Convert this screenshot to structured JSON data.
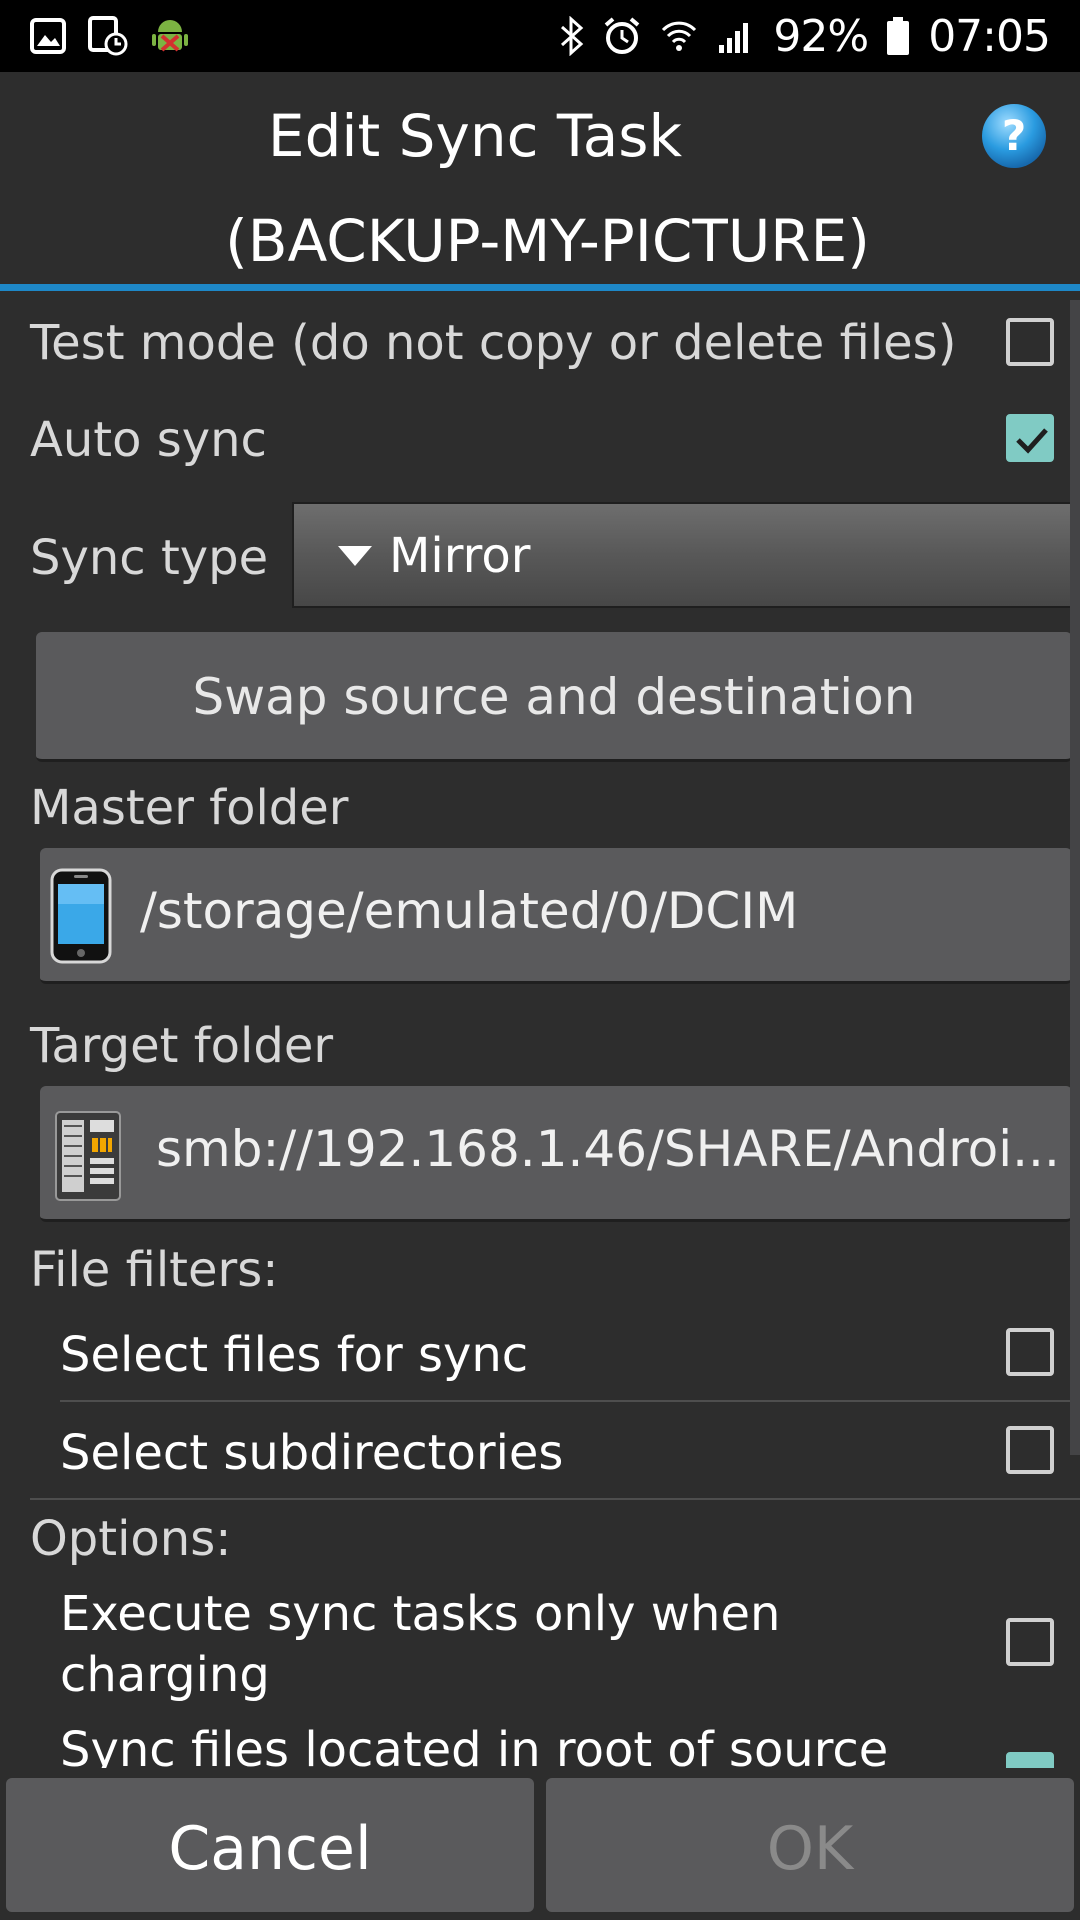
{
  "status_bar": {
    "battery_percent": "92%",
    "time": "07:05"
  },
  "title": {
    "line1": "Edit Sync Task",
    "line2": "(BACKUP-MY-PICTURE)"
  },
  "test_mode": {
    "label": "Test mode (do not copy or delete files)",
    "checked": false
  },
  "auto_sync": {
    "label": "Auto sync",
    "checked": true
  },
  "sync_type": {
    "label": "Sync type",
    "value": "Mirror"
  },
  "swap_button": {
    "label": "Swap source and destination"
  },
  "master_folder": {
    "label": "Master folder",
    "path": "/storage/emulated/0/DCIM"
  },
  "target_folder": {
    "label": "Target folder",
    "path": "smb://192.168.1.46/SHARE/Androi..."
  },
  "file_filters": {
    "label": "File filters:",
    "items": [
      {
        "label": "Select files for sync",
        "checked": false
      },
      {
        "label": "Select subdirectories",
        "checked": false
      }
    ]
  },
  "options": {
    "label": "Options:",
    "items": [
      {
        "label_line1": "Execute sync tasks only when",
        "label_line2": "charging",
        "checked": false
      },
      {
        "label_line1": "Sync files located in root of source",
        "checked": true
      }
    ]
  },
  "buttons": {
    "cancel": "Cancel",
    "ok": "OK"
  },
  "colors": {
    "accent_rule": "#1e88c8",
    "checkbox_checked": "#80cbc4",
    "background": "#2d2d2d",
    "button": "#5a5a5c"
  }
}
